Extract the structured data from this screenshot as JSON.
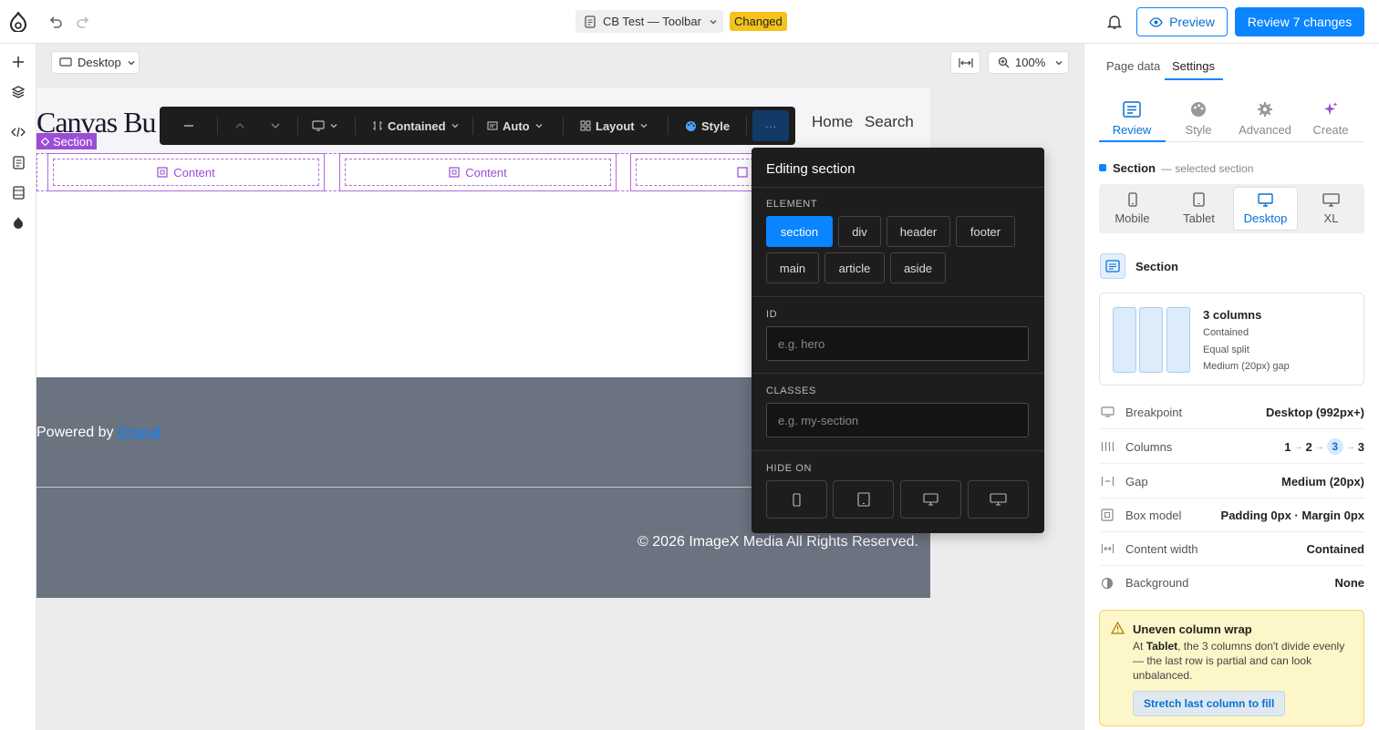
{
  "topbar": {
    "doc_title": "CB Test — Toolbar",
    "changed_badge": "Changed",
    "preview_label": "Preview",
    "review_label": "Review 7 changes"
  },
  "canvas": {
    "viewport_label": "Desktop",
    "zoom_label": "100%"
  },
  "site": {
    "logo_text": "Canvas Bu",
    "nav": [
      "Home",
      "Search"
    ],
    "section_tag": "Section",
    "content_label": "Content",
    "powered_prefix": "Powered by",
    "powered_link": "Drupal",
    "copyright": "© 2026 ImageX Media All Rights Reserved."
  },
  "toolbar": {
    "width_label": "Contained",
    "height_label": "Auto",
    "layout_label": "Layout",
    "style_label": "Style",
    "more_label": "···"
  },
  "popup": {
    "title": "Editing section",
    "element_label": "ELEMENT",
    "elements": [
      "section",
      "div",
      "header",
      "footer",
      "main",
      "article",
      "aside"
    ],
    "selected_element": "section",
    "id_label": "ID",
    "id_placeholder": "e.g. hero",
    "classes_label": "CLASSES",
    "classes_placeholder": "e.g. my-section",
    "hide_label": "HIDE ON"
  },
  "panel": {
    "tabs": [
      "Page data",
      "Settings"
    ],
    "active_tab": "Settings",
    "sub_tabs": [
      "Review",
      "Style",
      "Advanced",
      "Create"
    ],
    "active_sub_tab": "Review",
    "selected_title": "Section",
    "selected_suffix": "— selected section",
    "breakpoints": [
      "Mobile",
      "Tablet",
      "Desktop",
      "XL"
    ],
    "active_breakpoint": "Desktop",
    "component_name": "Section",
    "summary": {
      "title": "3 columns",
      "lines": [
        "Contained",
        "Equal split",
        "Medium (20px) gap"
      ]
    },
    "props": [
      {
        "key": "Breakpoint",
        "value": "Desktop (992px+)"
      },
      {
        "key": "Columns",
        "value": ""
      },
      {
        "key": "Gap",
        "value": "Medium (20px)"
      },
      {
        "key": "Box model",
        "value": "Padding 0px · Margin 0px"
      },
      {
        "key": "Content width",
        "value": "Contained"
      },
      {
        "key": "Background",
        "value": "None"
      }
    ],
    "columns_steps": [
      "1",
      "2",
      "3",
      "3"
    ],
    "warning": {
      "title": "Uneven column wrap",
      "body_prefix": "At",
      "body_strong": "Tablet",
      "body_rest": ", the 3 columns don't divide evenly — the last row is partial and can look unbalanced.",
      "action": "Stretch last column to fill"
    }
  },
  "colors": {
    "accent": "#0a84ff",
    "section_purple": "#9b4dd6",
    "badge_yellow": "#f5c21b",
    "footer_gray": "#6b7280"
  }
}
